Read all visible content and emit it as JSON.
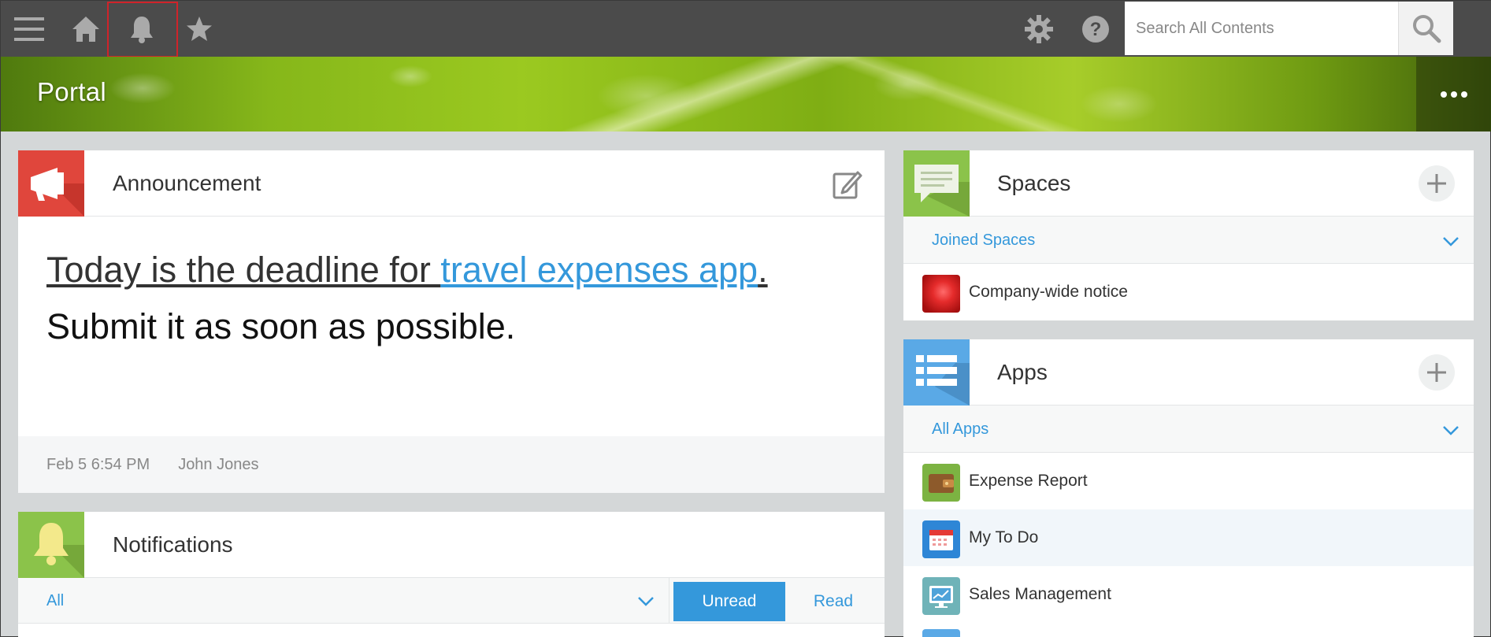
{
  "topbar": {
    "search_placeholder": "Search All Contents"
  },
  "banner": {
    "title": "Portal"
  },
  "announcement": {
    "title": "Announcement",
    "line1_prefix": "Today is the deadline for ",
    "line1_link": "travel expenses app",
    "line1_suffix": ".",
    "line2": "Submit it as soon as possible.",
    "date": "Feb 5 6:54 PM",
    "author": "John Jones"
  },
  "notifications": {
    "title": "Notifications",
    "filter": "All",
    "unread_label": "Unread",
    "read_label": "Read"
  },
  "spaces": {
    "title": "Spaces",
    "filter": "Joined Spaces",
    "items": [
      {
        "label": "Company-wide notice"
      }
    ]
  },
  "apps": {
    "title": "Apps",
    "filter": "All Apps",
    "items": [
      {
        "label": "Expense Report"
      },
      {
        "label": "My To Do"
      },
      {
        "label": "Sales Management"
      }
    ]
  },
  "colors": {
    "topbar": "#4b4b4b",
    "accent_blue": "#3498db",
    "announcement_icon": "#e0463c",
    "notifications_icon": "#8bc34a",
    "spaces_icon": "#8bc34a",
    "apps_icon": "#5aa9e6"
  },
  "icons": {
    "menu": "hamburger-icon",
    "home": "home-icon",
    "notifications": "bell-icon",
    "favorites": "star-icon",
    "settings": "gear-icon",
    "help": "help-icon",
    "search": "search-icon",
    "more": "more-dots-icon"
  }
}
